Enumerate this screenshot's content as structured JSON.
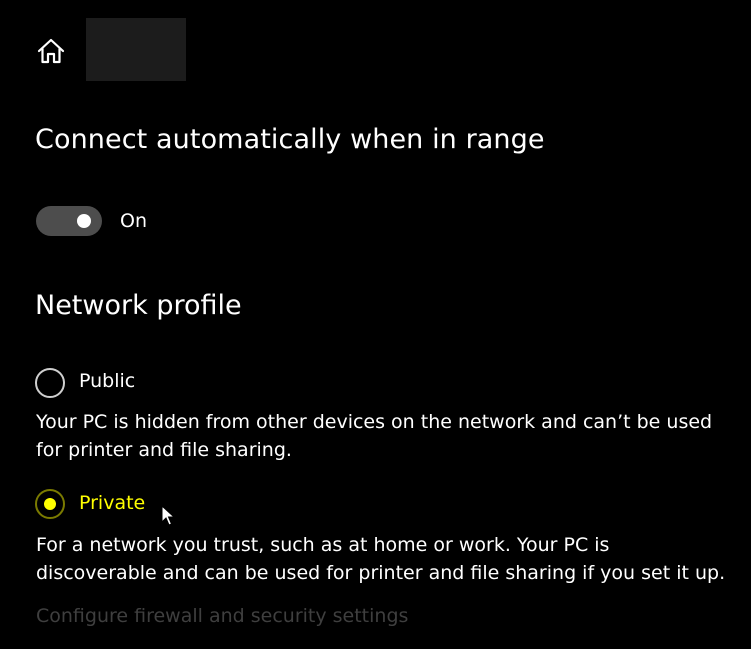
{
  "header": {
    "home_icon": "home-icon"
  },
  "connect_section": {
    "heading": "Connect automatically when in range",
    "toggle_state_label": "On"
  },
  "network_profile": {
    "heading": "Network profile",
    "options": [
      {
        "label": "Public",
        "selected": false,
        "description": "Your PC is hidden from other devices on the network and can’t be used for printer and file sharing."
      },
      {
        "label": "Private",
        "selected": true,
        "description": "For a network you trust, such as at home or work. Your PC is discoverable and can be used for printer and file sharing if you set it up."
      }
    ]
  },
  "links": {
    "firewall": "Configure firewall and security settings"
  },
  "colors": {
    "background": "#000000",
    "accent": "#ffff00",
    "toggle_track": "#4d4d4d",
    "disabled_text": "#3f3f3f"
  }
}
